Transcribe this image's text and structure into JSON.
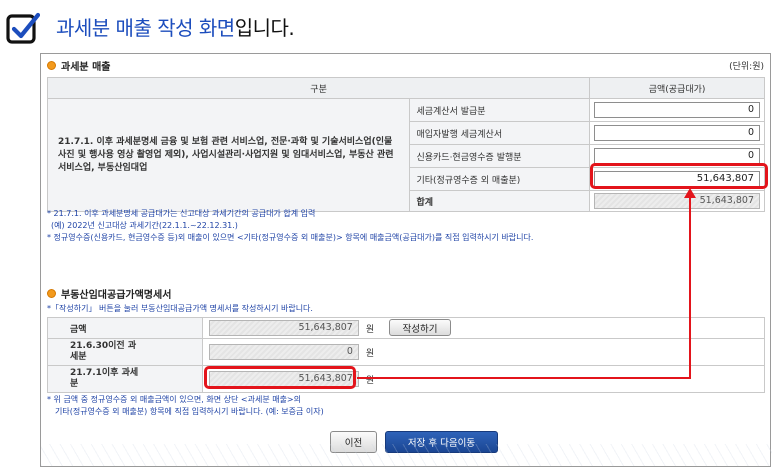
{
  "heading": {
    "highlight": "과세분 매출 작성 화면",
    "suffix": "입니다."
  },
  "sales_section": {
    "title": "과세분 매출",
    "unit": "(단위:원)",
    "col_category": "구분",
    "col_amount": "금액(공급대가)",
    "category_text": "21.7.1. 이후 과세분명세 금융 및 보험 관련 서비스업, 전문·과학 및 기술서비스업(인물사진 및 행사용 영상 촬영업 제외), 사업시설관리·사업지원 및 임대서비스업, 부동산 관련 서비스업, 부동산임대업",
    "rows": [
      {
        "label": "세금계산서 발급분",
        "value": "0"
      },
      {
        "label": "매입자발행 세금계산서",
        "value": "0"
      },
      {
        "label": "신용카드·현금영수증 발행분",
        "value": "0"
      },
      {
        "label": "기타(정규영수증 외 매출분)",
        "value": "51,643,807"
      }
    ],
    "total_label": "합계",
    "total_value": "51,643,807"
  },
  "sales_notes": [
    "* 21.7.1. 이후 과세분명세 공급대가는 신고대상 과세기간의 공급대가 합계 입력",
    "(예) 2022년 신고대상 과세기간(22.1.1.~22.12.31.)",
    "* 정규영수증(신용카드, 현금영수증 등)외 매출이 있으면 <기타(정규영수증 외 매출분)> 항목에 매출금액(공급대가)를 직접 입력하시기 바랍니다."
  ],
  "rental_section": {
    "title": "부동산임대공급가액명세서",
    "note": "*「작성하기」 버튼을 눌러 부동산임대공급가액 명세서를 작성하시기 바랍니다.",
    "rows": [
      {
        "label": "금액",
        "value": "51,643,807",
        "unit": "원"
      },
      {
        "label": "21.6.30이전 과세분",
        "value": "0",
        "unit": "원"
      },
      {
        "label": "21.7.1이후 과세분",
        "value": "51,643,807",
        "unit": "원"
      }
    ],
    "write_button": "작성하기"
  },
  "bottom_notes": [
    "* 위 금액 중 정규영수증 외 매출금액이 있으면, 화면 상단 <과세분 매출>의",
    "기타(정규영수증 외 매출분) 항목에 직접 입력하시기 바랍니다. (예: 보증금 이자)"
  ],
  "buttons": {
    "prev": "이전",
    "save_next": "저장 후 다음이동"
  },
  "colors": {
    "accent_blue": "#1c4dbd",
    "highlight_red": "#e3141b",
    "bullet_orange": "#f39a1c"
  }
}
